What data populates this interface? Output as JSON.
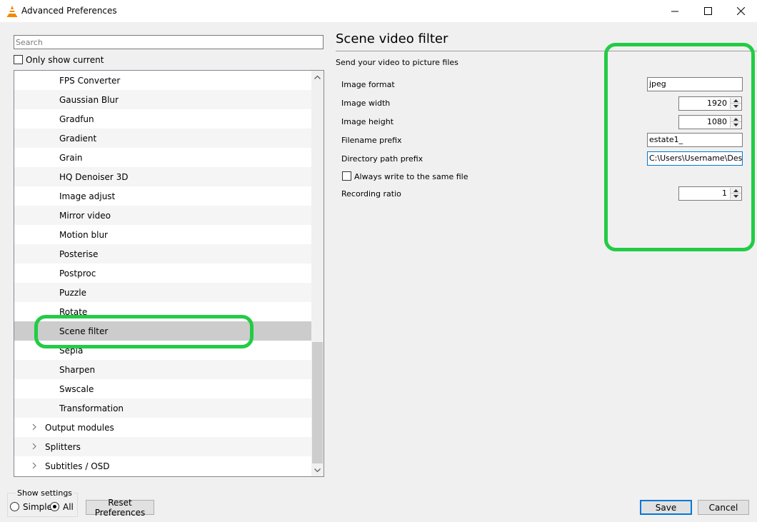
{
  "window": {
    "title": "Advanced Preferences",
    "controls": {
      "minimize": "minimize-icon",
      "maximize": "maximize-icon",
      "close": "close-icon"
    }
  },
  "sidebar": {
    "search_placeholder": "Search",
    "only_show_current": {
      "label": "Only show current",
      "checked": false
    },
    "tree_items": [
      {
        "label": "FPS Converter",
        "level": 2
      },
      {
        "label": "Gaussian Blur",
        "level": 2
      },
      {
        "label": "Gradfun",
        "level": 2
      },
      {
        "label": "Gradient",
        "level": 2
      },
      {
        "label": "Grain",
        "level": 2
      },
      {
        "label": "HQ Denoiser 3D",
        "level": 2
      },
      {
        "label": "Image adjust",
        "level": 2
      },
      {
        "label": "Mirror video",
        "level": 2
      },
      {
        "label": "Motion blur",
        "level": 2
      },
      {
        "label": "Posterise",
        "level": 2
      },
      {
        "label": "Postproc",
        "level": 2
      },
      {
        "label": "Puzzle",
        "level": 2
      },
      {
        "label": "Rotate",
        "level": 2
      },
      {
        "label": "Scene filter",
        "level": 2,
        "selected": true
      },
      {
        "label": "Sepia",
        "level": 2
      },
      {
        "label": "Sharpen",
        "level": 2
      },
      {
        "label": "Swscale",
        "level": 2
      },
      {
        "label": "Transformation",
        "level": 2
      },
      {
        "label": "Output modules",
        "level": 1,
        "expandable": true
      },
      {
        "label": "Splitters",
        "level": 1,
        "expandable": true
      },
      {
        "label": "Subtitles / OSD",
        "level": 1,
        "expandable": true
      }
    ]
  },
  "show_settings": {
    "title": "Show settings",
    "simple": "Simple",
    "all": "All",
    "selected": "All"
  },
  "footer": {
    "reset_label": "Reset Preferences",
    "save_label": "Save",
    "cancel_label": "Cancel"
  },
  "panel": {
    "title": "Scene video filter",
    "description": "Send your video to picture files",
    "image_format": {
      "label": "Image format",
      "value": "jpeg"
    },
    "image_width": {
      "label": "Image width",
      "value": "1920"
    },
    "image_height": {
      "label": "Image height",
      "value": "1080"
    },
    "filename_prefix": {
      "label": "Filename prefix",
      "value": "estate1_"
    },
    "directory_path_prefix": {
      "label": "Directory path prefix",
      "value": "C:\\Users\\Username\\Desktop"
    },
    "always_write_same_file": {
      "label": "Always write to the same file",
      "checked": false
    },
    "recording_ratio": {
      "label": "Recording ratio",
      "value": "1"
    }
  },
  "colors": {
    "highlight_annotation": "#22cc44",
    "selected_row": "#cccccc",
    "accent": "#0078d7",
    "vlc_orange": "#f08a00"
  }
}
